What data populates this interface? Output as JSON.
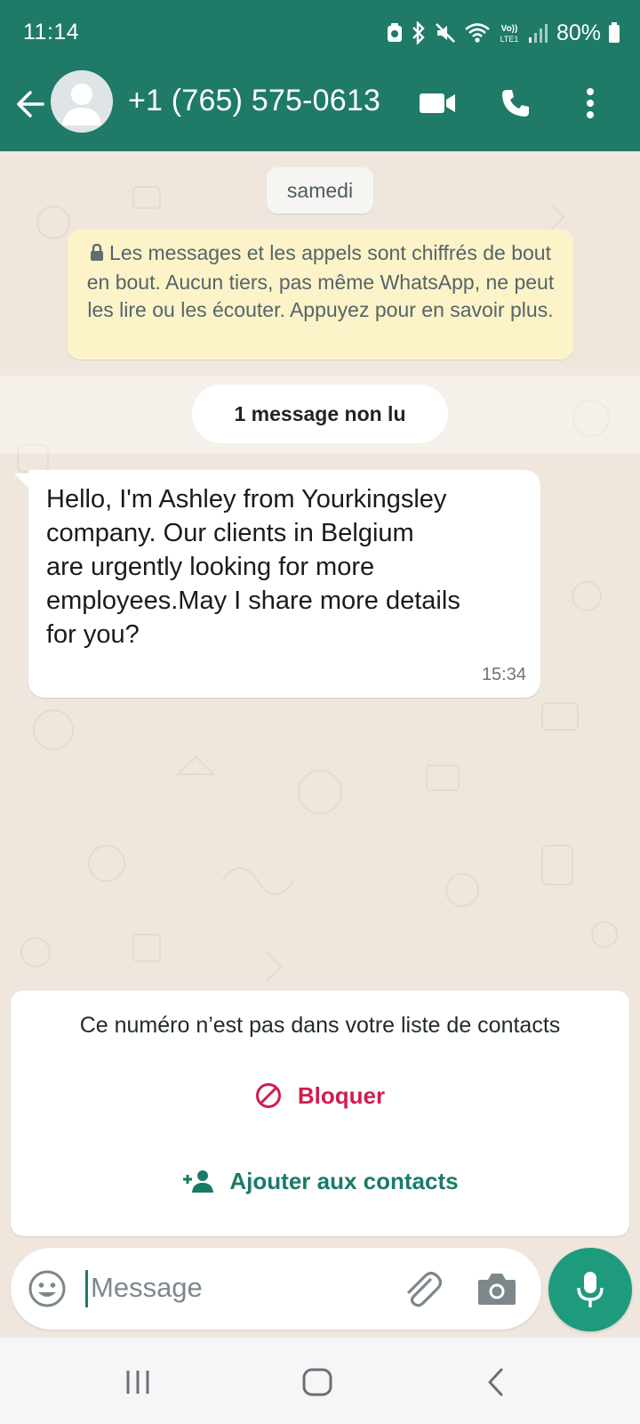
{
  "status_bar": {
    "time": "11:14",
    "battery": "80%",
    "icons": [
      "alarm-icon",
      "bluetooth-icon",
      "mute-icon",
      "wifi-icon",
      "volte-icon",
      "signal-icon",
      "battery-icon"
    ],
    "volte_label": "Vo)) LTE1"
  },
  "header": {
    "contact": "+1 (765) 575-0613",
    "actions": [
      "video-call-icon",
      "voice-call-icon",
      "more-options-icon"
    ]
  },
  "chat": {
    "date_chip": "samedi",
    "encryption_notice": "Les messages et les appels sont chiffrés de bout en bout. Aucun tiers, pas même WhatsApp, ne peut les lire ou les écouter. Appuyez pour en savoir plus.",
    "unread_banner": "1 message non lu",
    "messages": [
      {
        "direction": "incoming",
        "text": "Hello, I'm Ashley from Yourkingsley\ncompany. Our clients in Belgium\nare urgently looking for more\nemployees.May I share more details\nfor you?",
        "time": "15:34"
      }
    ]
  },
  "unknown_contact": {
    "notice": "Ce numéro n’est pas dans votre liste de contacts",
    "block_label": "Bloquer",
    "add_label": "Ajouter aux contacts"
  },
  "composer": {
    "placeholder": "Message",
    "value": ""
  },
  "colors": {
    "header": "#1f7a68",
    "chat_background": "#efe7de",
    "encryption_bg": "#fdf3c8",
    "block": "#cf1d4f",
    "add": "#1a7a68",
    "mic_button": "#1d9b7c"
  }
}
